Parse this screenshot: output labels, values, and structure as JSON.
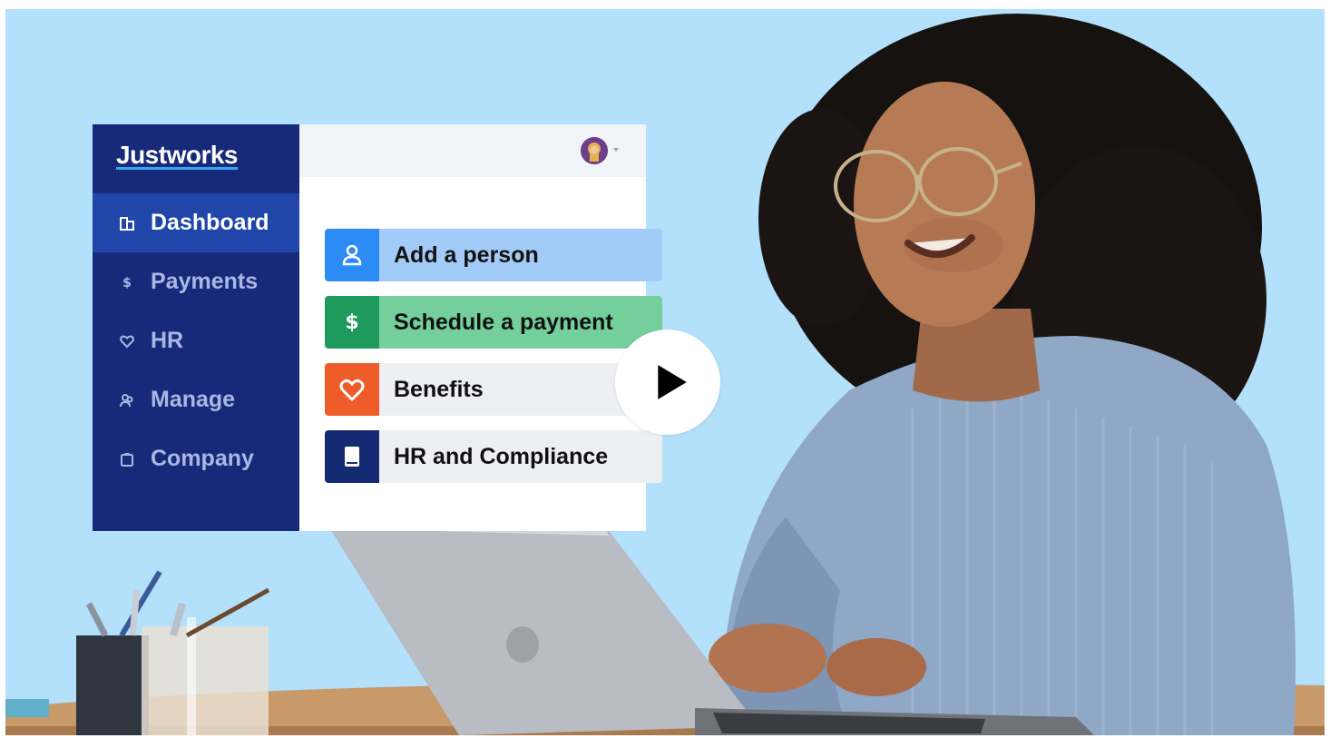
{
  "app": {
    "logo": "Justworks"
  },
  "sidebar": {
    "items": [
      {
        "label": "Dashboard",
        "icon": "building-icon",
        "active": true
      },
      {
        "label": "Payments",
        "icon": "dollar-icon",
        "active": false
      },
      {
        "label": "HR",
        "icon": "heart-icon",
        "active": false
      },
      {
        "label": "Manage",
        "icon": "people-icon",
        "active": false
      },
      {
        "label": "Company",
        "icon": "clipboard-icon",
        "active": false
      }
    ]
  },
  "header": {
    "avatar_icon": "user-avatar-icon"
  },
  "actions": [
    {
      "label": "Add a person",
      "icon": "person-icon",
      "accent": "#2d8bf5"
    },
    {
      "label": "Schedule a payment",
      "icon": "dollar-icon",
      "accent": "#1e9a5c"
    },
    {
      "label": "Benefits",
      "icon": "heart-icon",
      "accent": "#ee5c2a"
    },
    {
      "label": "HR and Compliance",
      "icon": "book-icon",
      "accent": "#142a73"
    }
  ],
  "video": {
    "play_icon": "play-icon"
  },
  "colors": {
    "background": "#b3e0fb",
    "sidebar": "#172a7a",
    "sidebar_active": "#1f46a8",
    "logo_underline": "#37a6f0"
  }
}
